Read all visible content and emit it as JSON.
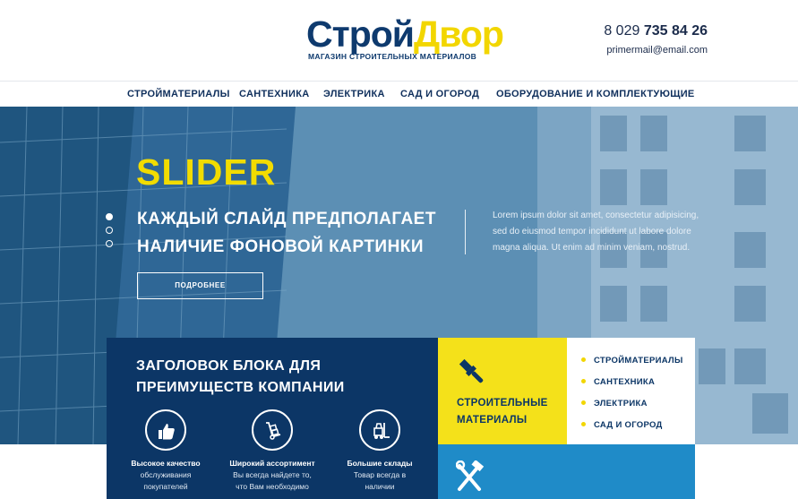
{
  "header": {
    "logo_part1": "Строй",
    "logo_part2": "Двор",
    "logo_sub": "МАГАЗИН СТРОИТЕЛЬНЫХ МАТЕРИАЛОВ",
    "phone_prefix": "8 029 ",
    "phone_number": "735 84 26",
    "email": "primermail@email.com"
  },
  "nav": {
    "items": [
      {
        "label": "СТРОЙМАТЕРИАЛЫ"
      },
      {
        "label": "САНТЕХНИКА"
      },
      {
        "label": "ЭЛЕКТРИКА"
      },
      {
        "label": "САД И ОГОРОД"
      },
      {
        "label": "ОБОРУДОВАНИЕ И КОМПЛЕКТУЮЩИЕ"
      }
    ]
  },
  "hero": {
    "title": "SLIDER",
    "line1": "КАЖДЫЙ СЛАЙД ПРЕДПОЛАГАЕТ",
    "line2": "НАЛИЧИЕ ФОНОВОЙ КАРТИНКИ",
    "lorem": "Lorem ipsum dolor sit amet, consectetur adipisicing, sed do eiusmod tempor incididunt ut labore dolore magna aliqua. Ut enim ad minim veniam, nostrud.",
    "button_label": "ПОДРОБНЕЕ",
    "slides_total": 3,
    "active_slide": 1
  },
  "advantages": {
    "title": "ЗАГОЛОВОК БЛОКА ДЛЯ ПРЕИМУЩЕСТВ КОМПАНИИ",
    "items": [
      {
        "icon": "thumbs-up-icon",
        "name": "Высокое качество",
        "desc1": "обслуживания",
        "desc2": "покупателей"
      },
      {
        "icon": "hand-truck-icon",
        "name": "Широкий ассортимент",
        "desc1": "Вы всегда найдете то,",
        "desc2": "что Вам необходимо"
      },
      {
        "icon": "forklift-icon",
        "name": "Большие склады",
        "desc1": "Товар всегда в",
        "desc2": "наличии"
      }
    ]
  },
  "category_box": {
    "icon": "paint-brush-icon",
    "label_line1": "СТРОИТЕЛЬНЫЕ",
    "label_line2": "МАТЕРИАЛЫ",
    "items": [
      {
        "label": "СТРОЙМАТЕРИАЛЫ"
      },
      {
        "label": "САНТЕХНИКА"
      },
      {
        "label": "ЭЛЕКТРИКА"
      },
      {
        "label": "САД И ОГОРОД"
      }
    ]
  },
  "tools_box": {
    "icon": "tools-icon"
  },
  "colors": {
    "brand_blue": "#0c3666",
    "brand_yellow": "#f4e11a",
    "accent_blue": "#1f8bc8"
  }
}
